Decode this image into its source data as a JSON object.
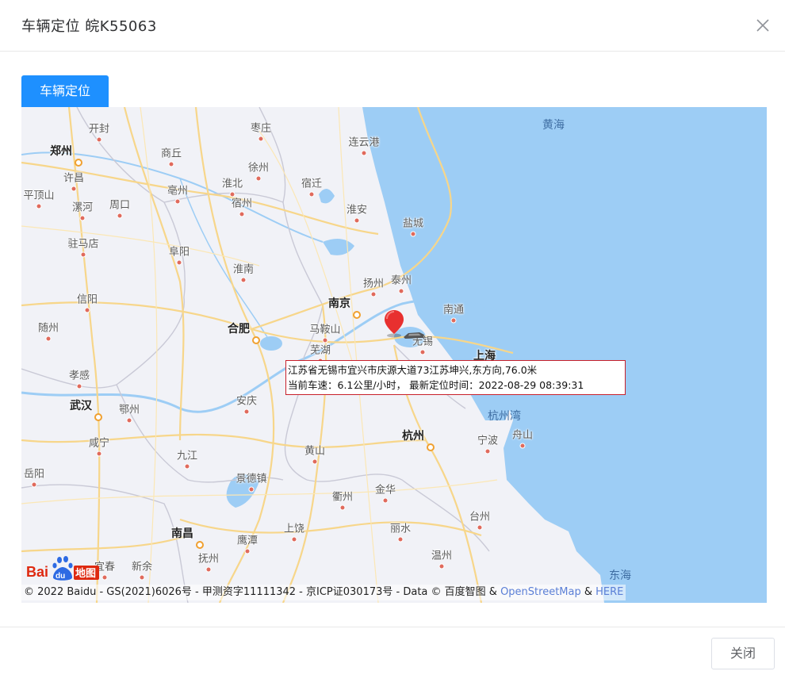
{
  "dialog": {
    "title": "车辆定位 皖K55063",
    "close_icon": "close-icon"
  },
  "tab": {
    "label": "车辆定位"
  },
  "map": {
    "cities": [
      {
        "name": "开封",
        "cls": ""
      },
      {
        "name": "郑州",
        "cls": "major"
      },
      {
        "name": "枣庄",
        "cls": ""
      },
      {
        "name": "商丘",
        "cls": ""
      },
      {
        "name": "许昌",
        "cls": ""
      },
      {
        "name": "徐州",
        "cls": ""
      },
      {
        "name": "连云港",
        "cls": ""
      },
      {
        "name": "平顶山",
        "cls": ""
      },
      {
        "name": "漯河",
        "cls": ""
      },
      {
        "name": "周口",
        "cls": ""
      },
      {
        "name": "亳州",
        "cls": ""
      },
      {
        "name": "淮北",
        "cls": ""
      },
      {
        "name": "宿迁",
        "cls": ""
      },
      {
        "name": "宿州",
        "cls": ""
      },
      {
        "name": "淮安",
        "cls": ""
      },
      {
        "name": "盐城",
        "cls": ""
      },
      {
        "name": "驻马店",
        "cls": ""
      },
      {
        "name": "阜阳",
        "cls": ""
      },
      {
        "name": "淮南",
        "cls": ""
      },
      {
        "name": "扬州",
        "cls": ""
      },
      {
        "name": "泰州",
        "cls": ""
      },
      {
        "name": "信阳",
        "cls": ""
      },
      {
        "name": "南京",
        "cls": "major"
      },
      {
        "name": "南通",
        "cls": ""
      },
      {
        "name": "合肥",
        "cls": "major"
      },
      {
        "name": "马鞍山",
        "cls": ""
      },
      {
        "name": "随州",
        "cls": ""
      },
      {
        "name": "无锡",
        "cls": ""
      },
      {
        "name": "芜湖",
        "cls": ""
      },
      {
        "name": "上海",
        "cls": "major"
      },
      {
        "name": "孝感",
        "cls": ""
      },
      {
        "name": "武汉",
        "cls": "major"
      },
      {
        "name": "鄂州",
        "cls": ""
      },
      {
        "name": "安庆",
        "cls": ""
      },
      {
        "name": "杭州湾",
        "cls": "sea"
      },
      {
        "name": "杭州",
        "cls": "major"
      },
      {
        "name": "咸宁",
        "cls": ""
      },
      {
        "name": "宁波",
        "cls": ""
      },
      {
        "name": "舟山",
        "cls": ""
      },
      {
        "name": "九江",
        "cls": ""
      },
      {
        "name": "黄山",
        "cls": ""
      },
      {
        "name": "岳阳",
        "cls": ""
      },
      {
        "name": "景德镇",
        "cls": ""
      },
      {
        "name": "金华",
        "cls": ""
      },
      {
        "name": "衢州",
        "cls": ""
      },
      {
        "name": "台州",
        "cls": ""
      },
      {
        "name": "南昌",
        "cls": "major"
      },
      {
        "name": "上饶",
        "cls": ""
      },
      {
        "name": "丽水",
        "cls": ""
      },
      {
        "name": "鹰潭",
        "cls": ""
      },
      {
        "name": "温州",
        "cls": ""
      },
      {
        "name": "抚州",
        "cls": ""
      },
      {
        "name": "宜春",
        "cls": ""
      },
      {
        "name": "新余",
        "cls": ""
      },
      {
        "name": "黄海",
        "cls": "sea"
      },
      {
        "name": "东海",
        "cls": "sea"
      }
    ],
    "info": {
      "line1": "江苏省无锡市宜兴市庆源大道73江苏坤兴,东方向,76.0米",
      "line2": "当前车速：6.1公里/小时，  最新定位时间：2022-08-29 08:39:31"
    },
    "logo": {
      "text": "Bai du 地图"
    },
    "copyright": {
      "text": "© 2022 Baidu - GS(2021)6026号 - 甲测资字11111342 - 京ICP证030173号 - Data © 百度智图 & ",
      "osm": "OpenStreetMap",
      "amp": " & ",
      "here": "HERE"
    }
  },
  "footer": {
    "close_label": "关闭"
  }
}
